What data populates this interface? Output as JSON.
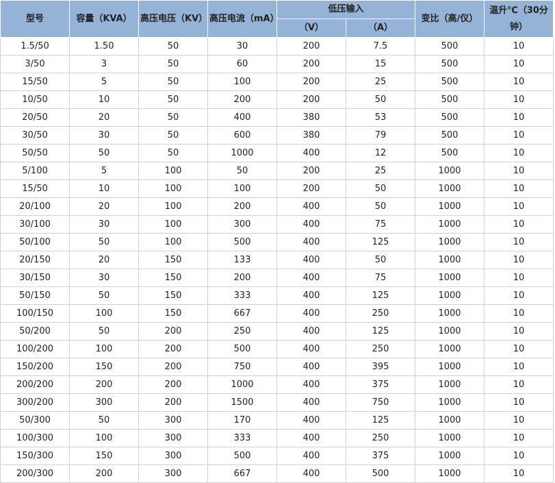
{
  "headers": {
    "model": "型号",
    "capacity": "容量（KVA）",
    "hv_voltage": "高压电压（KV）",
    "hv_current": "高压电流（mA）",
    "lv_input": "低压输入",
    "lv_v": "（V）",
    "lv_a": "（A）",
    "ratio": "变比（高/仪）",
    "temp_line1": "温升℃（30分",
    "temp_line2": "钟）"
  },
  "rows": [
    [
      "1.5/50",
      "1.50",
      "50",
      "30",
      "200",
      "7.5",
      "500",
      "10"
    ],
    [
      "3/50",
      "3",
      "50",
      "60",
      "200",
      "15",
      "500",
      "10"
    ],
    [
      "15/50",
      "5",
      "50",
      "100",
      "200",
      "25",
      "500",
      "10"
    ],
    [
      "10/50",
      "10",
      "50",
      "200",
      "200",
      "50",
      "500",
      "10"
    ],
    [
      "20/50",
      "20",
      "50",
      "400",
      "380",
      "53",
      "500",
      "10"
    ],
    [
      "30/50",
      "30",
      "50",
      "600",
      "380",
      "79",
      "500",
      "10"
    ],
    [
      "50/50",
      "50",
      "50",
      "1000",
      "400",
      "12",
      "500",
      "10"
    ],
    [
      "5/100",
      "5",
      "100",
      "50",
      "200",
      "25",
      "1000",
      "10"
    ],
    [
      "15/50",
      "10",
      "100",
      "100",
      "200",
      "50",
      "1000",
      "10"
    ],
    [
      "20/100",
      "20",
      "100",
      "200",
      "400",
      "50",
      "1000",
      "10"
    ],
    [
      "30/100",
      "30",
      "100",
      "300",
      "400",
      "75",
      "1000",
      "10"
    ],
    [
      "50/100",
      "50",
      "100",
      "500",
      "400",
      "125",
      "1000",
      "10"
    ],
    [
      "20/150",
      "20",
      "150",
      "133",
      "400",
      "50",
      "1000",
      "10"
    ],
    [
      "30/150",
      "30",
      "150",
      "200",
      "400",
      "75",
      "1000",
      "10"
    ],
    [
      "50/150",
      "50",
      "150",
      "333",
      "400",
      "125",
      "1000",
      "10"
    ],
    [
      "100/150",
      "100",
      "150",
      "667",
      "400",
      "250",
      "1000",
      "10"
    ],
    [
      "50/200",
      "50",
      "200",
      "250",
      "400",
      "125",
      "1000",
      "10"
    ],
    [
      "100/200",
      "100",
      "200",
      "500",
      "400",
      "250",
      "1000",
      "10"
    ],
    [
      "150/200",
      "150",
      "200",
      "750",
      "400",
      "395",
      "1000",
      "10"
    ],
    [
      "200/200",
      "200",
      "200",
      "1000",
      "400",
      "375",
      "1000",
      "10"
    ],
    [
      "300/200",
      "300",
      "200",
      "1500",
      "400",
      "750",
      "1000",
      "10"
    ],
    [
      "50/300",
      "50",
      "300",
      "170",
      "400",
      "125",
      "1000",
      "10"
    ],
    [
      "100/300",
      "100",
      "300",
      "333",
      "400",
      "250",
      "1000",
      "10"
    ],
    [
      "150/300",
      "150",
      "300",
      "500",
      "400",
      "375",
      "1000",
      "10"
    ],
    [
      "200/300",
      "200",
      "300",
      "667",
      "400",
      "500",
      "1000",
      "10"
    ]
  ],
  "colors": {
    "header_bg": "#95b3d7",
    "border": "#d0d0d0"
  }
}
